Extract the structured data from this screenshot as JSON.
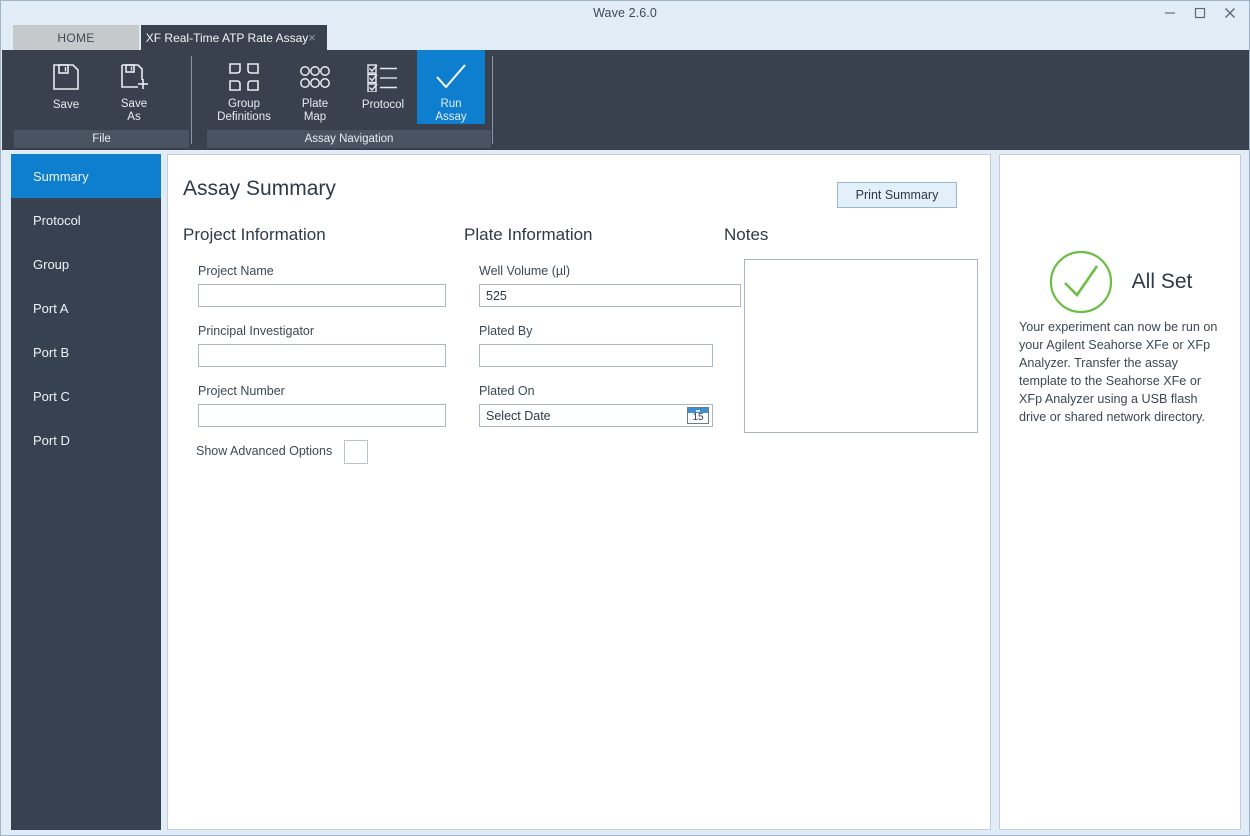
{
  "window": {
    "title": "Wave 2.6.0",
    "controls": {
      "minimize": "minimize-icon",
      "maximize": "maximize-icon",
      "close": "close-icon"
    }
  },
  "tabs": [
    {
      "label": "HOME",
      "active": false,
      "closeable": false
    },
    {
      "label": "XF Real-Time ATP Rate Assay",
      "active": true,
      "closeable": true,
      "close_glyph": "×"
    }
  ],
  "ribbon": {
    "groups": [
      {
        "label": "File",
        "items": [
          {
            "label_line1": "Save",
            "label_line2": "",
            "icon": "save-floppy-icon",
            "active": false
          },
          {
            "label_line1": "Save",
            "label_line2": "As",
            "icon": "save-as-floppy-plus-icon",
            "active": false
          }
        ]
      },
      {
        "label": "Assay Navigation",
        "items": [
          {
            "label_line1": "Group",
            "label_line2": "Definitions",
            "icon": "group-definitions-puzzle-icon",
            "active": false
          },
          {
            "label_line1": "Plate",
            "label_line2": "Map",
            "icon": "plate-map-wells-icon",
            "active": false
          },
          {
            "label_line1": "Protocol",
            "label_line2": "",
            "icon": "protocol-checklist-icon",
            "active": false
          },
          {
            "label_line1": "Run",
            "label_line2": "Assay",
            "icon": "run-assay-checkmark-icon",
            "active": true
          }
        ]
      }
    ]
  },
  "sidebar": {
    "items": [
      {
        "label": "Summary",
        "active": true
      },
      {
        "label": "Protocol",
        "active": false
      },
      {
        "label": "Group",
        "active": false
      },
      {
        "label": "Port A",
        "active": false
      },
      {
        "label": "Port B",
        "active": false
      },
      {
        "label": "Port C",
        "active": false
      },
      {
        "label": "Port D",
        "active": false
      }
    ]
  },
  "main": {
    "page_title": "Assay Summary",
    "print_summary_label": "Print Summary",
    "project_information": {
      "heading": "Project Information",
      "fields": [
        {
          "label": "Project Name",
          "value": "",
          "placeholder": ""
        },
        {
          "label": "Principal Investigator",
          "value": "",
          "placeholder": ""
        },
        {
          "label": "Project Number",
          "value": "",
          "placeholder": ""
        }
      ],
      "advanced_options_label": "Show Advanced Options",
      "advanced_options_checked": false
    },
    "plate_information": {
      "heading": "Plate Information",
      "fields": [
        {
          "label": "Well Volume (µl)",
          "value": "525",
          "placeholder": ""
        },
        {
          "label": "Plated By",
          "value": "",
          "placeholder": ""
        },
        {
          "label": "Plated On",
          "value": "Select Date",
          "placeholder": "Select Date",
          "calendar_day": "15"
        }
      ]
    },
    "notes": {
      "heading": "Notes",
      "value": "",
      "placeholder": ""
    }
  },
  "allset": {
    "title": "All Set",
    "icon": "circle-check-icon",
    "message": "Your experiment can now be run on your Agilent Seahorse XFe or XFp Analyzer. Transfer the assay template to the Seahorse XFe or XFp Analyzer using a USB flash drive or shared network directory."
  },
  "colors": {
    "accent_blue": "#0d7fce",
    "ribbon_dark": "#39414e",
    "sidebar_dark": "#374250",
    "window_chrome": "#e1ecf6",
    "success_green": "#6cbe45",
    "tab_inactive": "#c6c9cc"
  }
}
